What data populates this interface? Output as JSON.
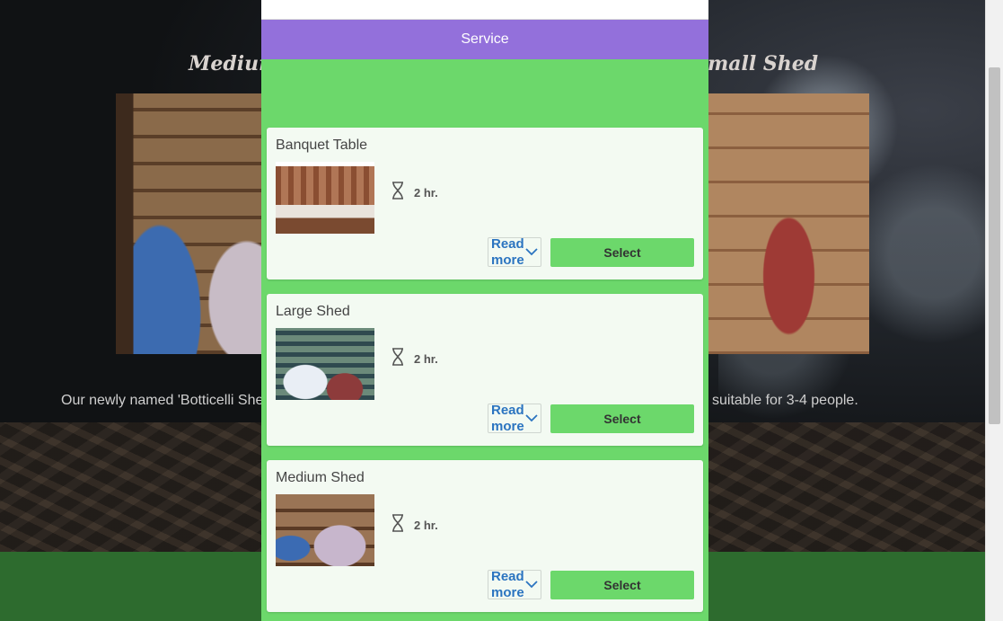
{
  "background": {
    "heading_left": "Medium",
    "heading_right": "mall Shed",
    "text_left": "Our newly named 'Botticelli She",
    "text_right": "suitable for 3-4 people."
  },
  "modal": {
    "header_title": "Service",
    "services": [
      {
        "name": "Banquet Table",
        "duration": "2 hr.",
        "read_more": "Read more",
        "select": "Select"
      },
      {
        "name": "Large Shed",
        "duration": "2 hr.",
        "read_more": "Read more",
        "select": "Select"
      },
      {
        "name": "Medium Shed",
        "duration": "2 hr.",
        "read_more": "Read more",
        "select": "Select"
      }
    ]
  },
  "icons": {
    "duration": "hourglass-icon",
    "read_more": "chevron-down-icon"
  },
  "colors": {
    "modal_bg": "#6cd86b",
    "header_bg": "#9370db",
    "card_bg": "#f3faf2",
    "select_button": "#6cd86b",
    "link": "#2b74c0"
  }
}
